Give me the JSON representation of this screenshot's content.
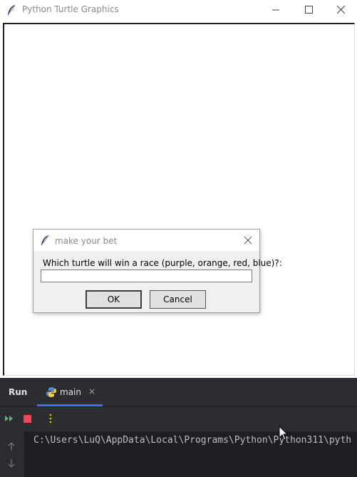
{
  "window": {
    "title": "Python Turtle Graphics",
    "icon": "feather-icon",
    "controls": [
      "minimize-icon",
      "maximize-icon",
      "close-icon"
    ]
  },
  "dialog": {
    "title": "make your bet",
    "prompt": "Which turtle will win a race (purple, orange, red, blue)?:",
    "input_value": "",
    "ok_label": "OK",
    "cancel_label": "Cancel"
  },
  "run_panel": {
    "run_label": "Run",
    "tab_label": "main",
    "tab_close": "×",
    "console_line": "C:\\Users\\LuQ\\AppData\\Local\\Programs\\Python\\Python311\\pyth",
    "colors": {
      "accent": "#3574f0",
      "stop": "#f2475a",
      "rerun": "#5fb865",
      "more": "#f0c000"
    }
  }
}
